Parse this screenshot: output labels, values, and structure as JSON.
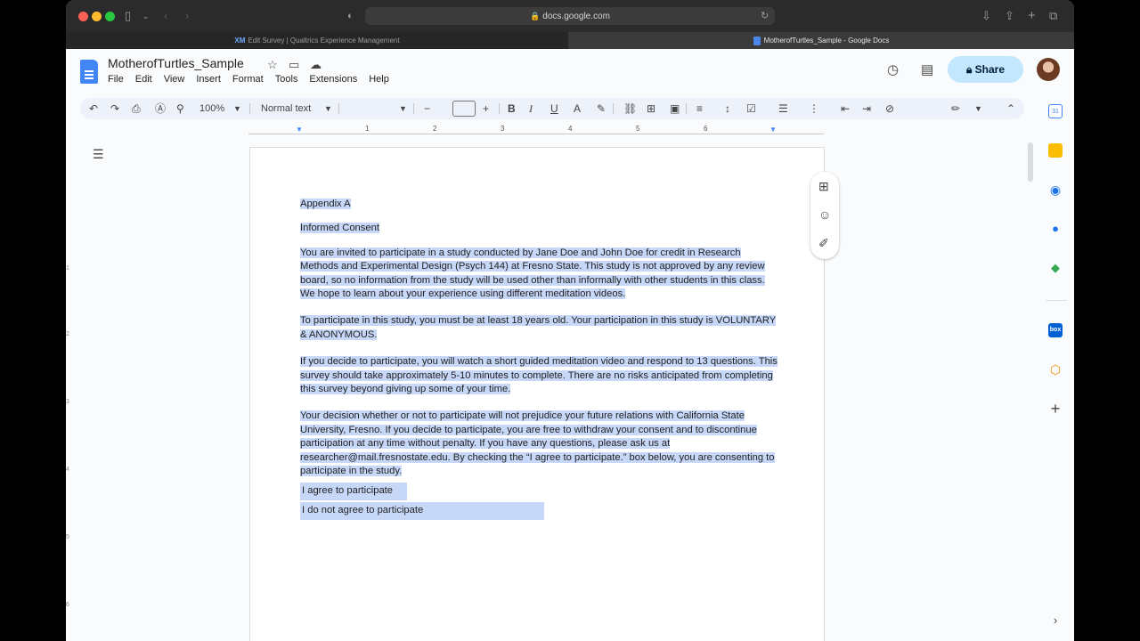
{
  "browser": {
    "url": "docs.google.com",
    "tabs": [
      {
        "label": "Edit Survey | Qualtrics Experience Management",
        "icon_text": "XM"
      },
      {
        "label": "MotherofTurtles_Sample - Google Docs"
      }
    ]
  },
  "docs": {
    "title": "MotherofTurtles_Sample",
    "menu": [
      "File",
      "Edit",
      "View",
      "Insert",
      "Format",
      "Tools",
      "Extensions",
      "Help"
    ],
    "share_label": "Share"
  },
  "toolbar": {
    "zoom": "100%",
    "style": "Normal text",
    "font": ""
  },
  "ruler": [
    "1",
    "2",
    "3",
    "4",
    "5",
    "6"
  ],
  "vruler": [
    "1",
    "2",
    "3",
    "4",
    "5",
    "6"
  ],
  "document": {
    "heading1": "Appendix A",
    "heading2": "Informed Consent",
    "para1": "You are invited to participate in a study conducted by Jane Doe and John Doe for credit in Research Methods and Experimental Design (Psych 144) at Fresno State. This study is not approved by any review board, so no information from the study will be used other than informally with other students in this class. We hope to learn about your experience using different meditation videos.",
    "para2": "To participate in this study, you must be at least 18 years old. Your participation in this study is VOLUNTARY & ANONYMOUS.",
    "para3": "If you decide to participate, you will watch a short guided meditation video and respond to 13 questions. This survey should take approximately 5-10 minutes to complete. There are no risks anticipated from completing this survey beyond giving up some of your time.",
    "para4": "Your decision whether or not to participate will not prejudice your future relations with California State University, Fresno. If you decide to participate, you are free to withdraw your consent and to discontinue participation at any time without penalty. If you have any questions, please ask us at researcher@mail.fresnostate.edu. By checking the “I agree to participate.” box below, you are consenting to participate in the study.",
    "option1": "I agree to participate",
    "option2": "I do not agree to participate"
  },
  "side_panel": {
    "box_label": "box"
  }
}
